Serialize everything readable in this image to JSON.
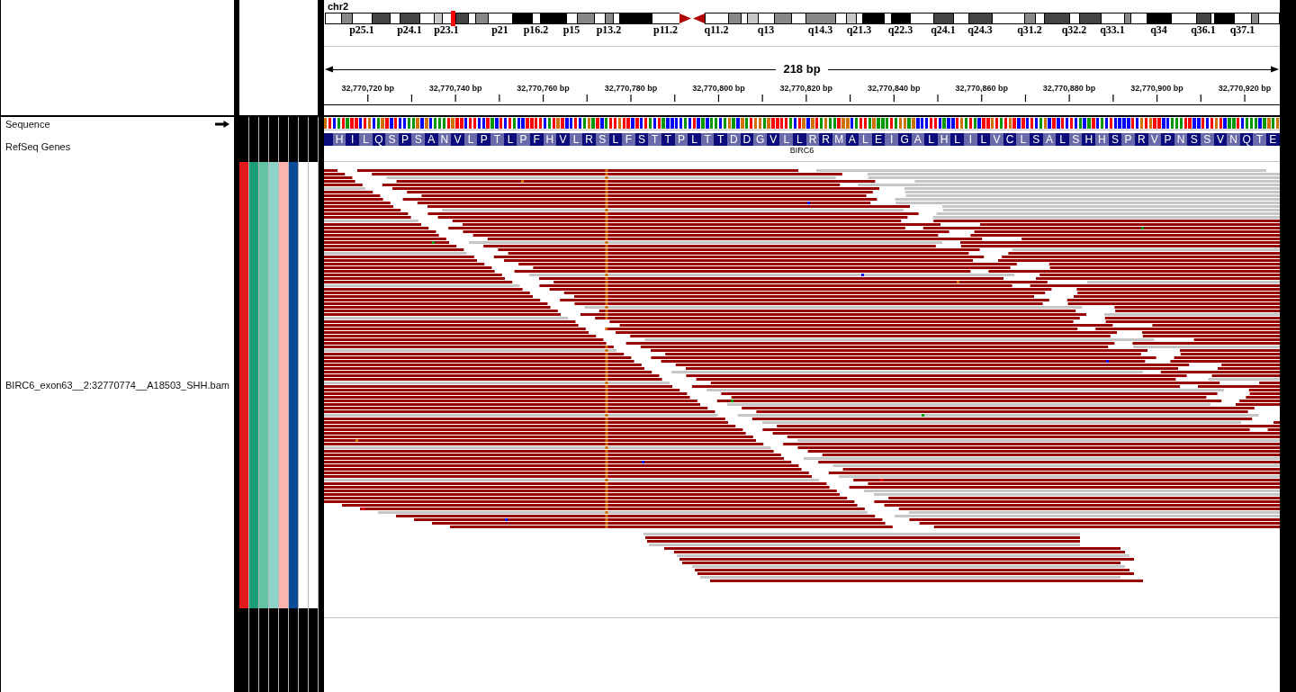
{
  "ideogram": {
    "chromosome": "chr2",
    "bands": [
      {
        "kind": "band",
        "color": "#ffffff"
      },
      {
        "kind": "band",
        "color": "#888888"
      },
      {
        "kind": "band",
        "color": "#ffffff",
        "label": "p25.1"
      },
      {
        "kind": "band",
        "color": "#444444"
      },
      {
        "kind": "band",
        "color": "#ffffff"
      },
      {
        "kind": "band",
        "color": "#444444",
        "label": "p24.1"
      },
      {
        "kind": "band",
        "color": "#ffffff"
      },
      {
        "kind": "band",
        "color": "#c8c8c8"
      },
      {
        "kind": "band",
        "color": "#ffffff",
        "label": "p23.1"
      },
      {
        "kind": "marker"
      },
      {
        "kind": "band",
        "color": "#444444"
      },
      {
        "kind": "band",
        "color": "#ffffff"
      },
      {
        "kind": "band",
        "color": "#888888"
      },
      {
        "kind": "band",
        "color": "#ffffff",
        "label": "p21"
      },
      {
        "kind": "band",
        "color": "#000000"
      },
      {
        "kind": "band",
        "color": "#ffffff",
        "label": "p16.2"
      },
      {
        "kind": "band",
        "color": "#000000"
      },
      {
        "kind": "band",
        "color": "#ffffff",
        "label": "p15"
      },
      {
        "kind": "band",
        "color": "#888888"
      },
      {
        "kind": "band",
        "color": "#ffffff"
      },
      {
        "kind": "band",
        "color": "#888888",
        "label": "p13.2"
      },
      {
        "kind": "band",
        "color": "#ffffff"
      },
      {
        "kind": "band",
        "color": "#000000"
      },
      {
        "kind": "band",
        "color": "#ffffff",
        "label": "p11.2"
      },
      {
        "kind": "centromere"
      },
      {
        "kind": "band",
        "color": "#ffffff",
        "label": "q11.2"
      },
      {
        "kind": "band",
        "color": "#888888"
      },
      {
        "kind": "band",
        "color": "#ffffff"
      },
      {
        "kind": "band",
        "color": "#c8c8c8"
      },
      {
        "kind": "band",
        "color": "#ffffff",
        "label": "q13"
      },
      {
        "kind": "band",
        "color": "#888888"
      },
      {
        "kind": "band",
        "color": "#ffffff"
      },
      {
        "kind": "band",
        "color": "#888888",
        "label": "q14.3"
      },
      {
        "kind": "band",
        "color": "#ffffff"
      },
      {
        "kind": "band",
        "color": "#c8c8c8"
      },
      {
        "kind": "band",
        "color": "#ffffff",
        "label": "q21.3"
      },
      {
        "kind": "band",
        "color": "#000000"
      },
      {
        "kind": "band",
        "color": "#ffffff"
      },
      {
        "kind": "band",
        "color": "#000000",
        "label": "q22.3"
      },
      {
        "kind": "band",
        "color": "#ffffff"
      },
      {
        "kind": "band",
        "color": "#444444",
        "label": "q24.1"
      },
      {
        "kind": "band",
        "color": "#ffffff"
      },
      {
        "kind": "band",
        "color": "#444444",
        "label": "q24.3"
      },
      {
        "kind": "band",
        "color": "#ffffff"
      },
      {
        "kind": "band",
        "color": "#888888",
        "label": "q31.2"
      },
      {
        "kind": "band",
        "color": "#ffffff"
      },
      {
        "kind": "band",
        "color": "#444444"
      },
      {
        "kind": "band",
        "color": "#ffffff",
        "label": "q32.2"
      },
      {
        "kind": "band",
        "color": "#444444"
      },
      {
        "kind": "band",
        "color": "#ffffff",
        "label": "q33.1"
      },
      {
        "kind": "band",
        "color": "#888888"
      },
      {
        "kind": "band",
        "color": "#ffffff"
      },
      {
        "kind": "band",
        "color": "#000000",
        "label": "q34"
      },
      {
        "kind": "band",
        "color": "#ffffff"
      },
      {
        "kind": "band",
        "color": "#444444",
        "label": "q36.1"
      },
      {
        "kind": "band",
        "color": "#ffffff"
      },
      {
        "kind": "band",
        "color": "#000000"
      },
      {
        "kind": "band",
        "color": "#ffffff",
        "label": "q37.1"
      },
      {
        "kind": "band",
        "color": "#888888"
      },
      {
        "kind": "band",
        "color": "#ffffff"
      }
    ]
  },
  "ruler": {
    "span": "218 bp",
    "ticks": [
      "32,770,720 bp",
      "32,770,740 bp",
      "32,770,760 bp",
      "32,770,780 bp",
      "32,770,800 bp",
      "32,770,820 bp",
      "32,770,840 bp",
      "32,770,860 bp",
      "32,770,880 bp",
      "32,770,900 bp",
      "32,770,920 bp"
    ]
  },
  "tracks": [
    {
      "kind": "sequence",
      "name": "Sequence",
      "bases": [
        {
          "color": "#d17105"
        },
        {
          "color": "#ff0000"
        },
        {
          "color": "#0000ff"
        },
        {
          "color": "#009600"
        },
        {
          "color": "#ff0000"
        },
        {
          "color": "#009600"
        },
        {
          "color": "#ff0000"
        },
        {
          "color": "#ff0000"
        },
        {
          "color": "#0000ff"
        },
        {
          "color": "#ff0000"
        },
        {
          "color": "#d17105"
        },
        {
          "color": "#0000ff"
        },
        {
          "color": "#009600"
        },
        {
          "color": "#d17105"
        },
        {
          "color": "#ff0000"
        },
        {
          "color": "#0000ff"
        },
        {
          "color": "#ff0000"
        },
        {
          "color": "#0000ff"
        },
        {
          "color": "#0000ff"
        },
        {
          "color": "#009600"
        },
        {
          "color": "#009600"
        },
        {
          "color": "#d17105"
        },
        {
          "color": "#0000ff"
        },
        {
          "color": "#d17105"
        },
        {
          "color": "#0000ff"
        },
        {
          "color": "#009600"
        },
        {
          "color": "#009600"
        },
        {
          "color": "#009600"
        },
        {
          "color": "#ff0000"
        },
        {
          "color": "#d17105"
        },
        {
          "color": "#ff0000"
        },
        {
          "color": "#ff0000"
        },
        {
          "color": "#0000ff"
        },
        {
          "color": "#ff0000"
        },
        {
          "color": "#ff0000"
        },
        {
          "color": "#0000ff"
        },
        {
          "color": "#0000ff"
        },
        {
          "color": "#ff0000"
        },
        {
          "color": "#009600"
        },
        {
          "color": "#0000ff"
        },
        {
          "color": "#ff0000"
        },
        {
          "color": "#0000ff"
        },
        {
          "color": "#ff0000"
        },
        {
          "color": "#009600"
        },
        {
          "color": "#0000ff"
        },
        {
          "color": "#0000ff"
        },
        {
          "color": "#ff0000"
        },
        {
          "color": "#ff0000"
        },
        {
          "color": "#ff0000"
        },
        {
          "color": "#ff0000"
        },
        {
          "color": "#0000ff"
        },
        {
          "color": "#009600"
        },
        {
          "color": "#ff0000"
        },
        {
          "color": "#d17105"
        },
        {
          "color": "#ff0000"
        },
        {
          "color": "#0000ff"
        },
        {
          "color": "#0000ff"
        },
        {
          "color": "#ff0000"
        },
        {
          "color": "#0000ff"
        },
        {
          "color": "#009600"
        },
        {
          "color": "#d17105"
        },
        {
          "color": "#009600"
        },
        {
          "color": "#ff0000"
        },
        {
          "color": "#0000ff"
        },
        {
          "color": "#009600"
        },
        {
          "color": "#ff0000"
        },
        {
          "color": "#ff0000"
        },
        {
          "color": "#d17105"
        },
        {
          "color": "#ff0000"
        },
        {
          "color": "#ff0000"
        },
        {
          "color": "#0000ff"
        },
        {
          "color": "#ff0000"
        },
        {
          "color": "#0000ff"
        },
        {
          "color": "#ff0000"
        },
        {
          "color": "#009600"
        },
        {
          "color": "#0000ff"
        },
        {
          "color": "#ff0000"
        },
        {
          "color": "#009600"
        },
        {
          "color": "#0000ff"
        },
        {
          "color": "#0000ff"
        },
        {
          "color": "#0000ff"
        },
        {
          "color": "#0000ff"
        },
        {
          "color": "#009600"
        },
        {
          "color": "#0000ff"
        },
        {
          "color": "#ff0000"
        },
        {
          "color": "#0000ff"
        },
        {
          "color": "#009600"
        },
        {
          "color": "#0000ff"
        },
        {
          "color": "#009600"
        },
        {
          "color": "#009600"
        },
        {
          "color": "#0000ff"
        },
        {
          "color": "#009600"
        },
        {
          "color": "#d17105"
        },
        {
          "color": "#009600"
        },
        {
          "color": "#0000ff"
        },
        {
          "color": "#d17105"
        },
        {
          "color": "#009600"
        },
        {
          "color": "#ff0000"
        },
        {
          "color": "#d17105"
        },
        {
          "color": "#d17105"
        },
        {
          "color": "#009600"
        },
        {
          "color": "#d17105"
        },
        {
          "color": "#ff0000"
        },
        {
          "color": "#ff0000"
        },
        {
          "color": "#ff0000"
        },
        {
          "color": "#ff0000"
        },
        {
          "color": "#009600"
        },
        {
          "color": "#0000ff"
        },
        {
          "color": "#ff0000"
        },
        {
          "color": "#d17105"
        },
        {
          "color": "#0000ff"
        },
        {
          "color": "#d17105"
        },
        {
          "color": "#ff0000"
        },
        {
          "color": "#009600"
        },
        {
          "color": "#d17105"
        },
        {
          "color": "#009600"
        },
        {
          "color": "#009600"
        },
        {
          "color": "#ff0000"
        },
        {
          "color": "#d17105"
        },
        {
          "color": "#d17105"
        },
        {
          "color": "#0000ff"
        },
        {
          "color": "#009600"
        },
        {
          "color": "#ff0000"
        },
        {
          "color": "#ff0000"
        },
        {
          "color": "#009600"
        },
        {
          "color": "#d17105"
        },
        {
          "color": "#009600"
        },
        {
          "color": "#009600"
        },
        {
          "color": "#009600"
        },
        {
          "color": "#ff0000"
        },
        {
          "color": "#009600"
        },
        {
          "color": "#d17105"
        },
        {
          "color": "#d17105"
        },
        {
          "color": "#009600"
        },
        {
          "color": "#d17105"
        },
        {
          "color": "#0000ff"
        },
        {
          "color": "#0000ff"
        },
        {
          "color": "#0000ff"
        },
        {
          "color": "#ff0000"
        },
        {
          "color": "#ff0000"
        },
        {
          "color": "#0000ff"
        },
        {
          "color": "#009600"
        },
        {
          "color": "#0000ff"
        },
        {
          "color": "#0000ff"
        },
        {
          "color": "#ff0000"
        },
        {
          "color": "#d17105"
        },
        {
          "color": "#009600"
        },
        {
          "color": "#ff0000"
        },
        {
          "color": "#009600"
        },
        {
          "color": "#0000ff"
        },
        {
          "color": "#ff0000"
        },
        {
          "color": "#ff0000"
        },
        {
          "color": "#d17105"
        },
        {
          "color": "#ff0000"
        },
        {
          "color": "#009600"
        },
        {
          "color": "#ff0000"
        },
        {
          "color": "#d17105"
        },
        {
          "color": "#ff0000"
        },
        {
          "color": "#0000ff"
        },
        {
          "color": "#ff0000"
        },
        {
          "color": "#0000ff"
        },
        {
          "color": "#ff0000"
        },
        {
          "color": "#0000ff"
        },
        {
          "color": "#009600"
        },
        {
          "color": "#d17105"
        },
        {
          "color": "#0000ff"
        },
        {
          "color": "#ff0000"
        },
        {
          "color": "#0000ff"
        },
        {
          "color": "#ff0000"
        },
        {
          "color": "#0000ff"
        },
        {
          "color": "#ff0000"
        },
        {
          "color": "#0000ff"
        },
        {
          "color": "#009600"
        },
        {
          "color": "#0000ff"
        },
        {
          "color": "#009600"
        },
        {
          "color": "#ff0000"
        },
        {
          "color": "#0000ff"
        },
        {
          "color": "#009600"
        },
        {
          "color": "#0000ff"
        },
        {
          "color": "#ff0000"
        },
        {
          "color": "#0000ff"
        },
        {
          "color": "#0000ff"
        },
        {
          "color": "#0000ff"
        },
        {
          "color": "#0000ff"
        },
        {
          "color": "#ff0000"
        },
        {
          "color": "#0000ff"
        },
        {
          "color": "#d17105"
        },
        {
          "color": "#ff0000"
        },
        {
          "color": "#d17105"
        },
        {
          "color": "#ff0000"
        },
        {
          "color": "#ff0000"
        },
        {
          "color": "#0000ff"
        },
        {
          "color": "#0000ff"
        },
        {
          "color": "#009600"
        },
        {
          "color": "#009600"
        },
        {
          "color": "#009600"
        },
        {
          "color": "#ff0000"
        },
        {
          "color": "#ff0000"
        },
        {
          "color": "#0000ff"
        },
        {
          "color": "#0000ff"
        },
        {
          "color": "#ff0000"
        },
        {
          "color": "#0000ff"
        },
        {
          "color": "#ff0000"
        },
        {
          "color": "#d17105"
        },
        {
          "color": "#ff0000"
        },
        {
          "color": "#0000ff"
        },
        {
          "color": "#009600"
        },
        {
          "color": "#009600"
        },
        {
          "color": "#ff0000"
        },
        {
          "color": "#0000ff"
        },
        {
          "color": "#009600"
        },
        {
          "color": "#009600"
        },
        {
          "color": "#009600"
        },
        {
          "color": "#0000ff"
        },
        {
          "color": "#009600"
        },
        {
          "color": "#d17105"
        },
        {
          "color": "#009600"
        },
        {
          "color": "#d17105"
        }
      ]
    },
    {
      "kind": "genes",
      "name": "RefSeq Genes",
      "gene": "BIRC6",
      "amino_acids": [
        "H",
        "I",
        "L",
        "Q",
        "S",
        "P",
        "S",
        "A",
        "N",
        "V",
        "L",
        "P",
        "T",
        "L",
        "P",
        "F",
        "H",
        "V",
        "L",
        "R",
        "S",
        "L",
        "F",
        "S",
        "T",
        "T",
        "P",
        "L",
        "T",
        "T",
        "D",
        "D",
        "G",
        "V",
        "L",
        "L",
        "R",
        "R",
        "M",
        "A",
        "L",
        "E",
        "I",
        "G",
        "A",
        "L",
        "H",
        "L",
        "I",
        "L",
        "V",
        "C",
        "L",
        "S",
        "A",
        "L",
        "S",
        "H",
        "H",
        "S",
        "P",
        "R",
        "V",
        "P",
        "N",
        "S",
        "S",
        "V",
        "N",
        "Q",
        "T",
        "E"
      ]
    },
    {
      "kind": "alignment",
      "name": "BIRC6_exon63__2:32770774__A18503_SHH.bam",
      "attributes": [
        {
          "color": "#e31a1c"
        },
        {
          "color": "#1b9e77"
        },
        {
          "color": "#66c2a5"
        },
        {
          "color": "#8dd3c7"
        },
        {
          "color": "#fbb4ae"
        },
        {
          "color": "#0b4a96"
        },
        {
          "color": "#ffffff"
        },
        {
          "color": "#ffffff"
        }
      ]
    }
  ]
}
